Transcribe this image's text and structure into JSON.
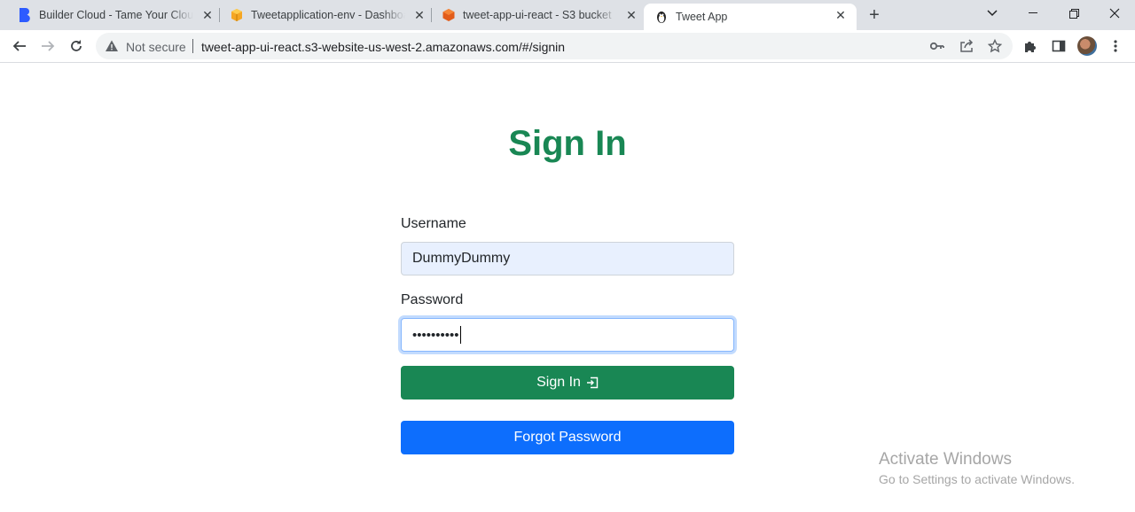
{
  "browser": {
    "tabs": [
      {
        "title": "Builder Cloud - Tame Your Cloud",
        "icon": "builder-b-icon"
      },
      {
        "title": "Tweetapplication-env - Dashboard",
        "icon": "aws-box-icon"
      },
      {
        "title": "tweet-app-ui-react - S3 bucket",
        "icon": "s3-bucket-icon"
      },
      {
        "title": "Tweet App",
        "icon": "penguin-icon"
      }
    ],
    "security_label": "Not secure",
    "url": "tweet-app-ui-react.s3-website-us-west-2.amazonaws.com/#/signin"
  },
  "page": {
    "title": "Sign In",
    "username_label": "Username",
    "username_value": "DummyDummy",
    "password_label": "Password",
    "password_value": "••••••••••",
    "signin_button": "Sign In",
    "forgot_button": "Forgot Password"
  },
  "watermark": {
    "line1": "Activate Windows",
    "line2": "Go to Settings to activate Windows."
  },
  "colors": {
    "accent_green": "#198754",
    "accent_blue": "#0d6efd"
  }
}
